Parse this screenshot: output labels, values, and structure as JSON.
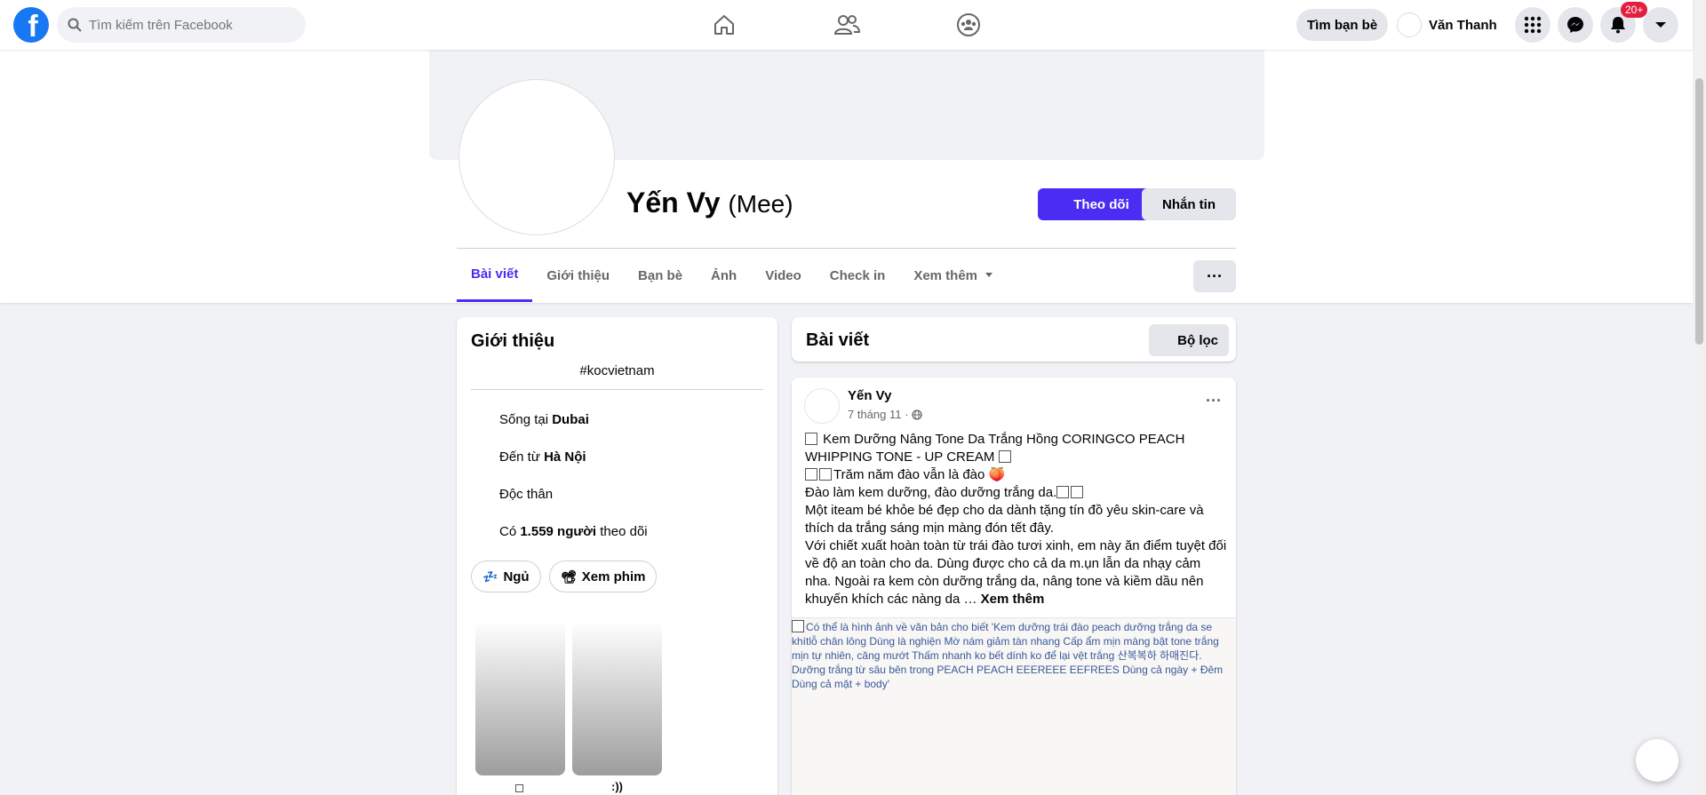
{
  "topnav": {
    "logo_letter": "f",
    "search_placeholder": "Tìm kiếm trên Facebook",
    "find_friends_label": "Tìm bạn bè",
    "user_name": "Văn Thanh",
    "notification_badge": "20+",
    "accent_color": "#1877f2"
  },
  "profile": {
    "name": "Yến Vy",
    "nickname": "(Mee)",
    "follow_label": "Theo dõi",
    "message_label": "Nhắn tin",
    "more_label": "···",
    "tabs": [
      "Bài viết",
      "Giới thiệu",
      "Bạn bè",
      "Ảnh",
      "Video",
      "Check in",
      "Xem thêm"
    ],
    "active_color": "#4a2cf2"
  },
  "intro": {
    "title": "Giới thiệu",
    "bio": "#kocvietnam",
    "lives_prefix": "Sống tại ",
    "lives_value": "Dubai",
    "from_prefix": "Đến từ ",
    "from_value": "Hà Nội",
    "relationship": "Độc thân",
    "followers_prefix": "Có ",
    "followers_value": "1.559 người",
    "followers_suffix": " theo dõi",
    "hobbies": [
      {
        "icon": "💤",
        "label": "Ngủ"
      },
      {
        "icon": "📽",
        "label": "Xem phim"
      }
    ],
    "highlights": [
      "",
      ":))"
    ]
  },
  "posts": {
    "header_title": "Bài viết",
    "filter_label": "Bộ lọc"
  },
  "post": {
    "author": "Yến Vy",
    "date": "7 tháng 11 ·",
    "menu": "···",
    "lines": [
      "Kem Dưỡng Nâng Tone Da Trắng Hồng CORINGCO PEACH WHIPPING TONE - UP CREAM",
      "Trăm năm đào vẫn là đào",
      "Đào làm kem dưỡng, đào dưỡng trắng da.",
      "Một iteam bé khỏe bé đẹp cho da dành tặng tín đồ yêu skin-care và thích da trắng sáng mịn màng đón tết đây.",
      "Với chiết xuất hoàn toàn từ trái đào  tươi xinh, em này ăn điểm tuyệt đối về độ an toàn cho da. Dùng được cho cả da m.ụn lẫn da nhạy cảm nha. Ngoài ra kem còn dưỡng trắng da, nâng tone và kiềm dầu nên khuyến khích các nàng da …"
    ],
    "see_more": "Xem thêm",
    "image_alt": "Có thể là hình ảnh về văn bản cho biết 'Kem dưỡng trái đào peach dưỡng trắng da se khítlỗ chân lông Dùng là nghiện Mờ nám giảm tàn nhang Cấp ẩm mịn màng bật tone trắng mịn tự nhiên, căng mướt Thấm nhanh ko bết dính ko để lại vệt trắng 산복복하 하매진다. Dưỡng trắng từ sâu bên trong PEACH PEACH EEEREEE EEFREES Dùng cả ngày + Đêm Dùng cả mặt + body'"
  }
}
